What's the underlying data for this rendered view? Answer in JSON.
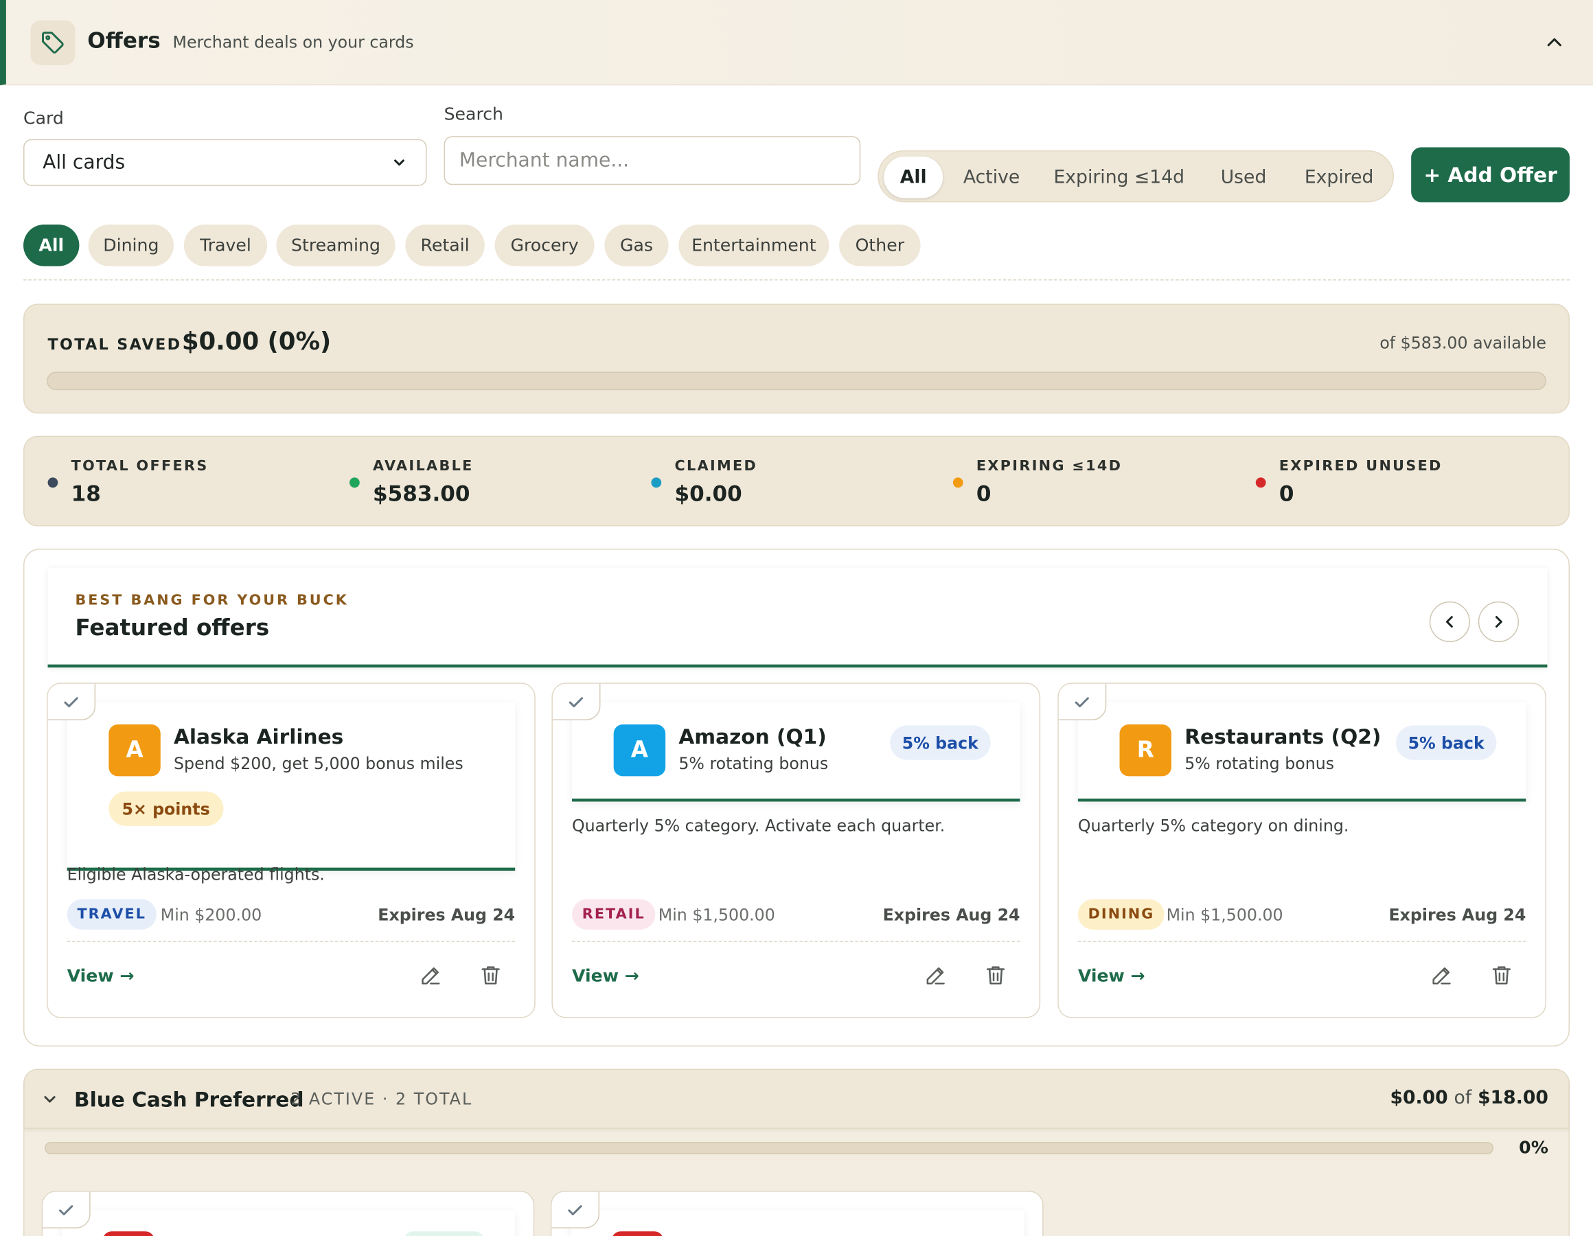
{
  "header": {
    "title": "Offers",
    "subtitle": "Merchant deals on your cards",
    "icon": "tag-icon",
    "collapse_icon": "chevron-up-icon"
  },
  "filters": {
    "card_label": "Card",
    "card_value": "All cards",
    "search_label": "Search",
    "search_placeholder": "Merchant name...",
    "status_tabs": [
      "All",
      "Active",
      "Expiring ≤14d",
      "Used",
      "Expired"
    ],
    "status_active": "All",
    "add_button": "+ Add Offer",
    "categories": [
      "All",
      "Dining",
      "Travel",
      "Streaming",
      "Retail",
      "Grocery",
      "Gas",
      "Entertainment",
      "Other"
    ],
    "category_active": "All"
  },
  "total_saved": {
    "label": "TOTAL SAVED",
    "value": "$0.00 (0%)",
    "available": "of $583.00 available",
    "progress_fraction": 0
  },
  "stats": [
    {
      "label": "TOTAL OFFERS",
      "value": "18",
      "color": "#3c4a5c"
    },
    {
      "label": "AVAILABLE",
      "value": "$583.00",
      "color": "#1fa55b"
    },
    {
      "label": "CLAIMED",
      "value": "$0.00",
      "color": "#1a9cc4"
    },
    {
      "label": "EXPIRING ≤14D",
      "value": "0",
      "color": "#f29a12"
    },
    {
      "label": "EXPIRED UNUSED",
      "value": "0",
      "color": "#d62828"
    }
  ],
  "featured": {
    "kicker": "BEST BANG FOR YOUR BUCK",
    "title": "Featured offers",
    "prev_icon": "chevron-left-icon",
    "next_icon": "chevron-right-icon",
    "cards": [
      {
        "avatar": "A",
        "avatar_color": "#f29a12",
        "name": "Alaska Airlines",
        "subtitle": "Spend $200, get 5,000 bonus miles",
        "points_badge": "5× points",
        "description": "Eligible Alaska-operated flights.",
        "category": "TRAVEL",
        "category_bg": "#e6eefa",
        "category_fg": "#1d4fa8",
        "min": "Min $200.00",
        "expires": "Expires Aug 24",
        "view": "View →"
      },
      {
        "avatar": "A",
        "avatar_color": "#12a3e6",
        "name": "Amazon (Q1)",
        "subtitle": "5% rotating bonus",
        "back_badge": "5% back",
        "description": "Quarterly 5% category. Activate each quarter.",
        "category": "RETAIL",
        "category_bg": "#fbe6ee",
        "category_fg": "#a3214f",
        "min": "Min $1,500.00",
        "expires": "Expires Aug 24",
        "view": "View →"
      },
      {
        "avatar": "R",
        "avatar_color": "#f29a12",
        "name": "Restaurants (Q2)",
        "subtitle": "5% rotating bonus",
        "back_badge": "5% back",
        "description": "Quarterly 5% category on dining.",
        "category": "DINING",
        "category_bg": "#fdf0c8",
        "category_fg": "#8a4a10",
        "min": "Min $1,500.00",
        "expires": "Expires Aug 24",
        "view": "View →"
      }
    ]
  },
  "group": {
    "name": "Blue Cash Preferred",
    "meta": "2 ACTIVE · 2 TOTAL",
    "saved": "$0.00",
    "of": "of",
    "total": "$18.00",
    "percent": "0%",
    "progress_fraction": 0,
    "card_avatar_colors": [
      "#d62828",
      "#d62828"
    ]
  }
}
